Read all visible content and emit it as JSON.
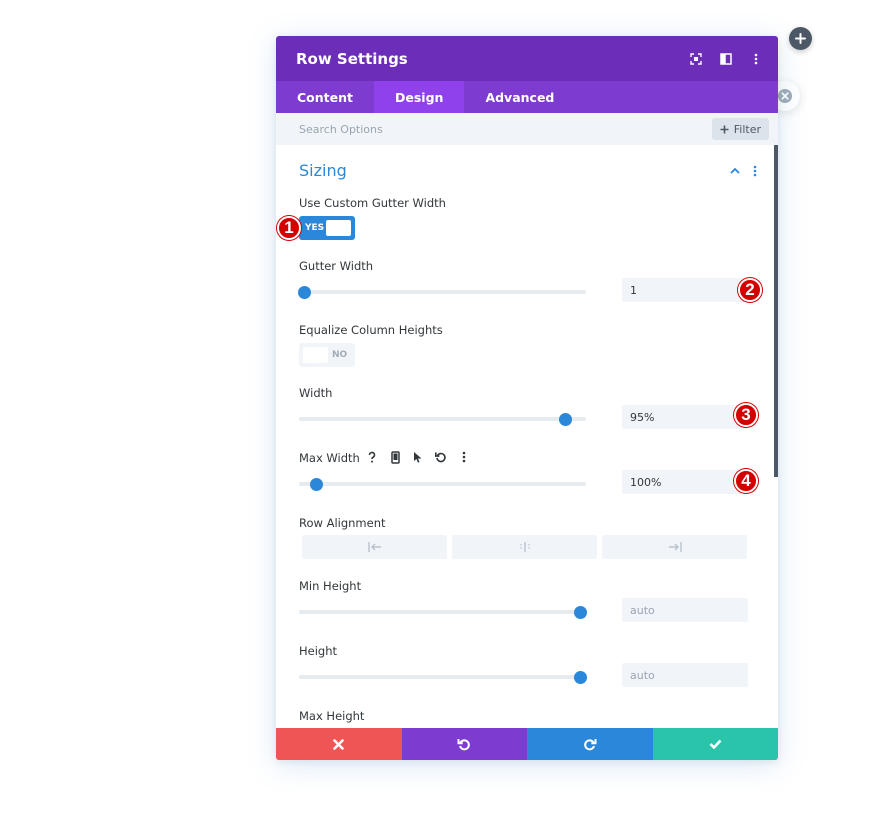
{
  "modal": {
    "title": "Row Settings",
    "header_icons": [
      "expand-icon",
      "sidebar-layout-icon",
      "more-vertical-icon"
    ]
  },
  "tabs": [
    {
      "label": "Content",
      "active": false
    },
    {
      "label": "Design",
      "active": true
    },
    {
      "label": "Advanced",
      "active": false
    }
  ],
  "search": {
    "placeholder": "Search Options",
    "filter_label": "Filter"
  },
  "section": {
    "title": "Sizing"
  },
  "fields": {
    "custom_gutter": {
      "label": "Use Custom Gutter Width",
      "state_text": "YES"
    },
    "gutter_width": {
      "label": "Gutter Width",
      "value": "1",
      "slider_percent": 2
    },
    "equalize": {
      "label": "Equalize Column Heights",
      "state_text": "NO"
    },
    "width": {
      "label": "Width",
      "value": "95%",
      "slider_percent": 93
    },
    "max_width": {
      "label": "Max Width",
      "value": "100%",
      "slider_percent": 6,
      "tools": [
        "help-icon",
        "mobile-icon",
        "cursor-icon",
        "reset-icon",
        "more-vertical-icon"
      ]
    },
    "row_alignment": {
      "label": "Row Alignment",
      "options": [
        "align-left-icon",
        "align-center-icon",
        "align-right-icon"
      ]
    },
    "min_height": {
      "label": "Min Height",
      "placeholder": "auto",
      "slider_percent": 98
    },
    "height": {
      "label": "Height",
      "placeholder": "auto",
      "slider_percent": 98
    },
    "max_height": {
      "label": "Max Height"
    }
  },
  "badges": [
    "1",
    "2",
    "3",
    "4"
  ],
  "footer": {
    "buttons": [
      {
        "name": "cancel",
        "icon": "close-icon",
        "color": "#ef5555"
      },
      {
        "name": "undo",
        "icon": "undo-icon",
        "color": "#7e3bd0"
      },
      {
        "name": "redo",
        "icon": "redo-icon",
        "color": "#2b87da"
      },
      {
        "name": "save",
        "icon": "check-icon",
        "color": "#29c4a9"
      }
    ]
  },
  "colors": {
    "header": "#6c2eb9",
    "tabs": "#7e3bd0",
    "active_tab": "#8f42ec",
    "accent": "#2b87da",
    "badge": "#d30000"
  }
}
